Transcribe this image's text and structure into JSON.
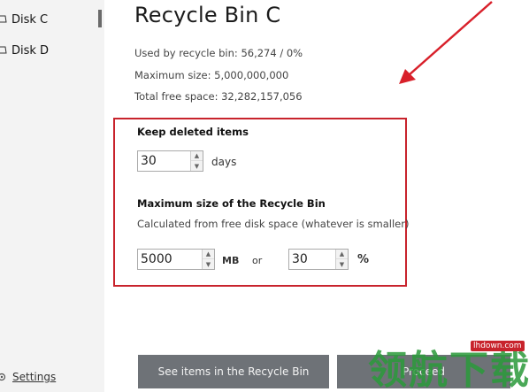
{
  "sidebar": {
    "items": [
      {
        "label": "Disk C",
        "selected": true
      },
      {
        "label": "Disk D",
        "selected": false
      }
    ],
    "settings_label": "Settings"
  },
  "main": {
    "title": "Recycle Bin C",
    "used": "Used by recycle bin: 56,274 / 0%",
    "max_size": "Maximum size: 5,000,000,000",
    "free_space": "Total free space: 32,282,157,056"
  },
  "options": {
    "keep_heading": "Keep deleted items",
    "keep_value": "30",
    "keep_unit": "days",
    "maxsize_heading": "Maximum size of the Recycle Bin",
    "maxsize_desc": "Calculated from free disk space (whatever is smaller)",
    "mb_value": "5000",
    "mb_unit": "MB",
    "or_label": "or",
    "percent_value": "30",
    "percent_unit": "%"
  },
  "buttons": {
    "see_items": "See items in the Recycle Bin",
    "second": "Proceed"
  },
  "watermark": {
    "chars": "领航下载",
    "url": "lhdown.com"
  },
  "colors": {
    "highlight_border": "#c8232c",
    "arrow": "#d8202a",
    "button_bg": "#6e7277",
    "sidebar_bg": "#f3f3f3"
  }
}
